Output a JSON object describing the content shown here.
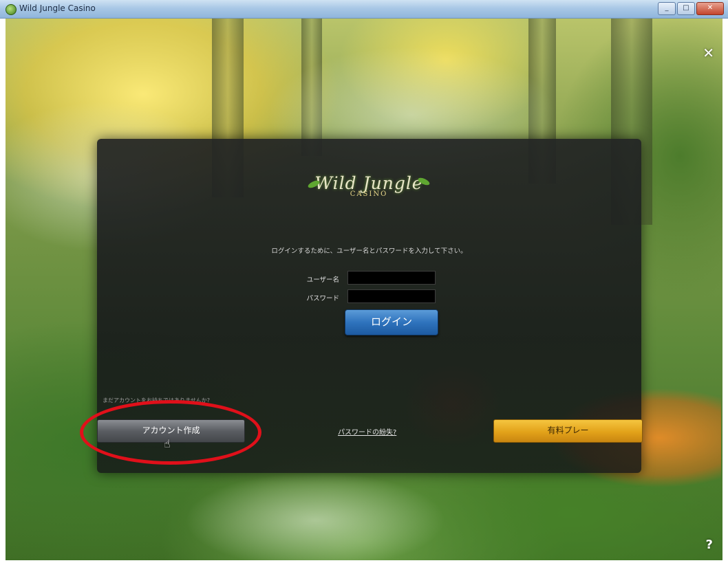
{
  "window": {
    "title": "Wild Jungle Casino",
    "controls": {
      "minimize": "_",
      "maximize": "□",
      "close": "✕"
    }
  },
  "overlay": {
    "close_glyph": "✕",
    "help_glyph": "?"
  },
  "login": {
    "logo_main": "Wild Jungle",
    "logo_sub": "CASINO",
    "instruction": "ログインするために、ユーザー名とパスワードを入力して下さい。",
    "username_label": "ユーザー名",
    "password_label": "パスワード",
    "login_button": "ログイン"
  },
  "footer": {
    "promo_text": "まだアカウントをお持ちではありませんか?",
    "create_account_button": "アカウント作成",
    "forgot_password_link": "パスワードの紛失?",
    "real_play_button": "有料プレー"
  },
  "colors": {
    "login_button": "#2f73bd",
    "real_play_button": "#e2a21a",
    "highlight_ring": "#e0101a"
  }
}
